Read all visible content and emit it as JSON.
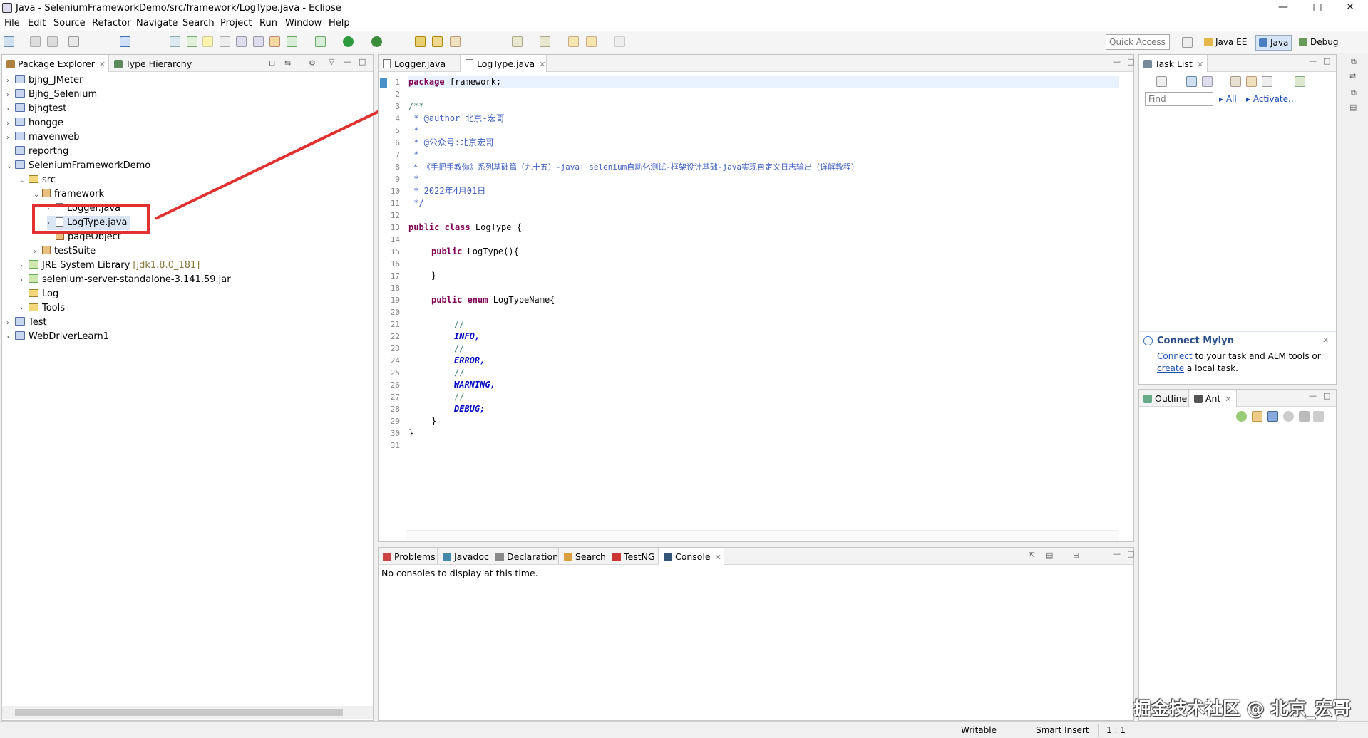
{
  "window": {
    "title": "Java - SeleniumFrameworkDemo/src/framework/LogType.java - Eclipse",
    "controls": {
      "minimize": "—",
      "maximize": "□",
      "close": "✕"
    }
  },
  "menu": [
    "File",
    "Edit",
    "Source",
    "Refactor",
    "Navigate",
    "Search",
    "Project",
    "Run",
    "Window",
    "Help"
  ],
  "toolbar": {
    "quick_access": "Quick Access",
    "perspectives": {
      "javaee": "Java EE",
      "java": "Java",
      "debug": "Debug"
    }
  },
  "left_panel": {
    "tabs": {
      "package_explorer": "Package Explorer",
      "type_hierarchy": "Type Hierarchy"
    },
    "tree": {
      "bjhg_jmeter": "bjhg_JMeter",
      "bjhg_selenium": "Bjhg_Selenium",
      "bjhgtest": "bjhgtest",
      "hongge": "hongge",
      "mavenweb": "mavenweb",
      "reportng": "reportng",
      "project": "SeleniumFrameworkDemo",
      "src": "src",
      "framework": "framework",
      "logger": "Logger.java",
      "logtype": "LogType.java",
      "pageobject": "pageObject",
      "testsuite": "testSuite",
      "jre": "JRE System Library",
      "jre_version": "[jdk1.8.0_181]",
      "selenium_jar": "selenium-server-standalone-3.141.59.jar",
      "log": "Log",
      "tools": "Tools",
      "test": "Test",
      "webdriver": "WebDriverLearn1"
    }
  },
  "editor": {
    "tabs": {
      "logger": "Logger.java",
      "logtype": "LogType.java"
    },
    "line_numbers": [
      "1",
      "2",
      "3",
      "4",
      "5",
      "6",
      "7",
      "8",
      "9",
      "10",
      "11",
      "12",
      "13",
      "14",
      "15",
      "16",
      "17",
      "18",
      "19",
      "20",
      "21",
      "22",
      "23",
      "24",
      "25",
      "26",
      "27",
      "28",
      "29",
      "30",
      "31"
    ],
    "code": {
      "l1_kw": "package",
      "l1_rest": " framework;",
      "l3": "/**",
      "l4": " * @author 北京-宏哥",
      "l5": " *",
      "l6": " * @公众号:北京宏哥",
      "l7": " *",
      "l8": " * 《手把手教你》系列基础篇（九十五）-java+ selenium自动化测试-框架设计基础-java实现自定义日志输出（详解教程）",
      "l9": " *",
      "l10": " * 2022年4月01日",
      "l11": " */",
      "l13_kw": "public class",
      "l13_rest": " LogType {",
      "l15_kw": "public",
      "l15_rest": " LogType(){",
      "l17": "}",
      "l19_kw": "public enum",
      "l19_rest": " LogTypeName{",
      "l21": "//",
      "l22": "INFO,",
      "l23": "//",
      "l24": "ERROR,",
      "l25": "//",
      "l26": "WARNING,",
      "l27": "//",
      "l28": "DEBUG;",
      "l29": "}",
      "l30": "}"
    }
  },
  "console": {
    "tabs": {
      "problems": "Problems",
      "javadoc": "Javadoc",
      "declaration": "Declaration",
      "search": "Search",
      "testng": "TestNG",
      "console": "Console"
    },
    "message": "No consoles to display at this time."
  },
  "task_list": {
    "tab": "Task List",
    "find_placeholder": "Find",
    "all": "All",
    "activate": "Activate...",
    "mylyn_title": "Connect Mylyn",
    "mylyn_connect": "Connect",
    "mylyn_text1": " to your task and ALM tools or",
    "mylyn_create": "create",
    "mylyn_text2": " a local task."
  },
  "outline_panel": {
    "tabs": {
      "outline": "Outline",
      "ant": "Ant"
    }
  },
  "statusbar": {
    "writable": "Writable",
    "insert": "Smart Insert",
    "position": "1 : 1"
  },
  "watermark": "掘金技术社区 @ 北京_宏哥",
  "colors": {
    "highlight_red": "#e0302f",
    "keyword": "#7f0055",
    "comment": "#3f7f5f",
    "enum": "#0000c0"
  }
}
